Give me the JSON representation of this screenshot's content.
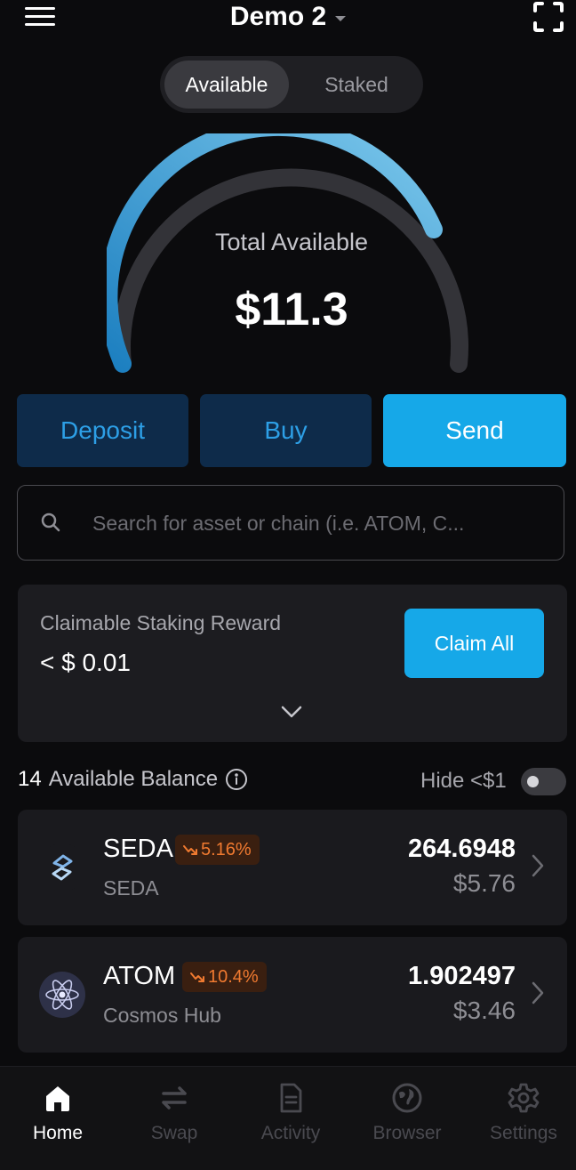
{
  "header": {
    "wallet_name": "Demo 2"
  },
  "toggle": {
    "available_label": "Available",
    "staked_label": "Staked"
  },
  "summary": {
    "label": "Total Available",
    "value": "$11.3"
  },
  "actions": {
    "deposit": "Deposit",
    "buy": "Buy",
    "send": "Send"
  },
  "search": {
    "placeholder": "Search for asset or chain (i.e. ATOM, C..."
  },
  "reward": {
    "label": "Claimable Staking Reward",
    "value": "< $ 0.01",
    "claim_label": "Claim All"
  },
  "balances": {
    "count": "14",
    "label": "Available Balance",
    "hide_label": "Hide <$1",
    "hide_enabled": false
  },
  "assets": [
    {
      "symbol": "SEDA",
      "chain": "SEDA",
      "change": "5.16%",
      "amount": "264.6948",
      "usd": "$5.76"
    },
    {
      "symbol": "ATOM",
      "chain": "Cosmos Hub",
      "change": "10.4%",
      "amount": "1.902497",
      "usd": "$3.46"
    }
  ],
  "tabs": [
    {
      "label": "Home",
      "icon": "home-icon",
      "active": true
    },
    {
      "label": "Swap",
      "icon": "swap-icon",
      "active": false
    },
    {
      "label": "Activity",
      "icon": "activity-icon",
      "active": false
    },
    {
      "label": "Browser",
      "icon": "globe-icon",
      "active": false
    },
    {
      "label": "Settings",
      "icon": "gear-icon",
      "active": false
    }
  ],
  "colors": {
    "accent": "#16a8e8",
    "negative": "#f07a30",
    "dark_button": "#0e2b4a"
  }
}
